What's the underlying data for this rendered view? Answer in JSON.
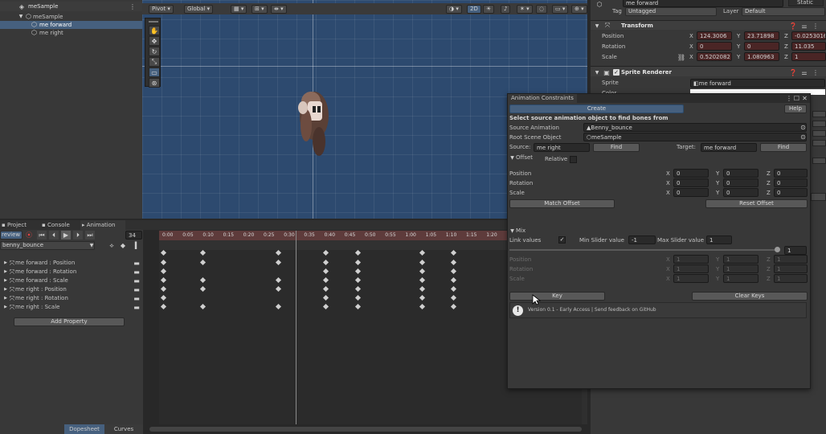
{
  "hierarchy": {
    "root": "meSample",
    "items": [
      {
        "label": "meSample"
      },
      {
        "label": "me forward"
      },
      {
        "label": "me right"
      }
    ]
  },
  "scene_toolbar": {
    "pivot": "Pivot",
    "global": "Global",
    "mode_2d": "2D"
  },
  "inspector": {
    "object_name": "me forward",
    "static_label": "Static",
    "tag_label": "Tag",
    "tag_value": "Untagged",
    "layer_label": "Layer",
    "layer_value": "Default",
    "transform": {
      "title": "Transform",
      "rows": [
        {
          "label": "Position",
          "x": "124.3006",
          "y": "23.71898",
          "z": "-0.02530162"
        },
        {
          "label": "Rotation",
          "x": "0",
          "y": "0",
          "z": "11.035"
        },
        {
          "label": "Scale",
          "x": "0.5202082",
          "y": "1.080963",
          "z": "1"
        }
      ]
    },
    "sprite_renderer": {
      "title": "Sprite Renderer",
      "sprite_label": "Sprite",
      "sprite_value": "me forward",
      "color_label": "Color"
    }
  },
  "tabs": {
    "project": "Project",
    "console": "Console",
    "animation": "Animation"
  },
  "animation": {
    "preview_label": "review",
    "frame": "34",
    "clip": "benny_bounce",
    "properties": [
      "me forward : Position",
      "me forward : Rotation",
      "me forward : Scale",
      "me right : Position",
      "me right : Rotation",
      "me right : Scale"
    ],
    "add_property": "Add Property",
    "dopesheet": "Dopesheet",
    "curves": "Curves",
    "ticks": [
      "0:00",
      "0:05",
      "0:10",
      "0:15",
      "0:20",
      "0:25",
      "0:30",
      "0:35",
      "0:40",
      "0:45",
      "0:50",
      "0:55",
      "1:00",
      "1:05",
      "1:10",
      "1:15",
      "1:20"
    ]
  },
  "dialog": {
    "title": "Animation Constraints",
    "create": "Create",
    "help": "Help",
    "select_text": "Select source animation object to find bones from",
    "source_animation_label": "Source Animation",
    "source_animation_value": "Benny_bounce",
    "root_scene_label": "Root Scene Object",
    "root_scene_value": "meSample",
    "source_label": "Source:",
    "source_value": "me right",
    "find": "Find",
    "target_label": "Target:",
    "target_value": "me forward",
    "offset_label": "Offset",
    "relative_label": "Relative",
    "offset_rows": [
      {
        "label": "Position",
        "x": "0",
        "y": "0",
        "z": "0"
      },
      {
        "label": "Rotation",
        "x": "0",
        "y": "0",
        "z": "0"
      },
      {
        "label": "Scale",
        "x": "0",
        "y": "0",
        "z": "0"
      }
    ],
    "match_offset": "Match Offset",
    "reset_offset": "Reset Offset",
    "mix_label": "Mix",
    "link_values": "Link values",
    "min_slider_label": "Min Slider value",
    "min_slider_value": "-1",
    "max_slider_label": "Max Slider value",
    "max_slider_value": "1",
    "slider_value": "1",
    "slider_level": 1.0,
    "mix_rows": [
      {
        "label": "Position",
        "x": "1",
        "y": "1",
        "z": "1"
      },
      {
        "label": "Rotation",
        "x": "1",
        "y": "1",
        "z": "1"
      },
      {
        "label": "Scale",
        "x": "1",
        "y": "1",
        "z": "1"
      }
    ],
    "key": "Key",
    "clear_keys": "Clear Keys",
    "version_text": "Version 0.1 - Early Access | Send feedback on GitHub"
  },
  "axis": {
    "x": "X",
    "y": "Y",
    "z": "Z"
  }
}
